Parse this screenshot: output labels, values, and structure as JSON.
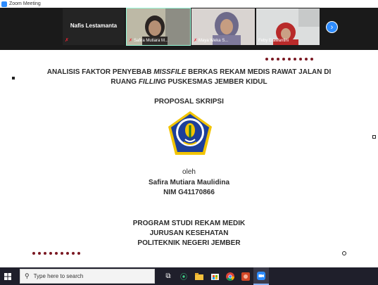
{
  "window": {
    "title": "Zoom Meeting"
  },
  "gallery": {
    "name_tile": "Nafis Lestamanta",
    "participants": [
      {
        "name": "Safira Mutiara M..."
      },
      {
        "name": "Maya Weka S..."
      },
      {
        "name": "Feby Erawantini"
      }
    ]
  },
  "slide": {
    "title_part1": "ANALISIS FAKTOR PENYEBAB ",
    "title_italic1": "MISSFILE",
    "title_part2": " BERKAS REKAM MEDIS RAWAT JALAN DI",
    "title_line2_a": "RUANG ",
    "title_italic2": "FILLING",
    "title_line2_b": " PUSKESMAS JEMBER KIDUL",
    "subtitle": "PROPOSAL SKRIPSI",
    "by": "oleh",
    "author": "Safira Mutiara Maulidina",
    "nim": "NIM G41170866",
    "program": "PROGRAM STUDI REKAM MEDIK",
    "department": "JURUSAN KESEHATAN",
    "institution": "POLITEKNIK NEGERI JEMBER"
  },
  "taskbar": {
    "search_placeholder": "Type here to search",
    "icons": [
      "windows-start-icon",
      "task-view-icon",
      "maps-icon",
      "file-explorer-icon",
      "store-icon",
      "chrome-icon",
      "powerpoint-icon",
      "zoom-icon"
    ]
  },
  "colors": {
    "accent": "#2d8cff",
    "dots": "#7a1822",
    "logo_blue": "#1d3f9a",
    "logo_yellow": "#f2c400"
  }
}
